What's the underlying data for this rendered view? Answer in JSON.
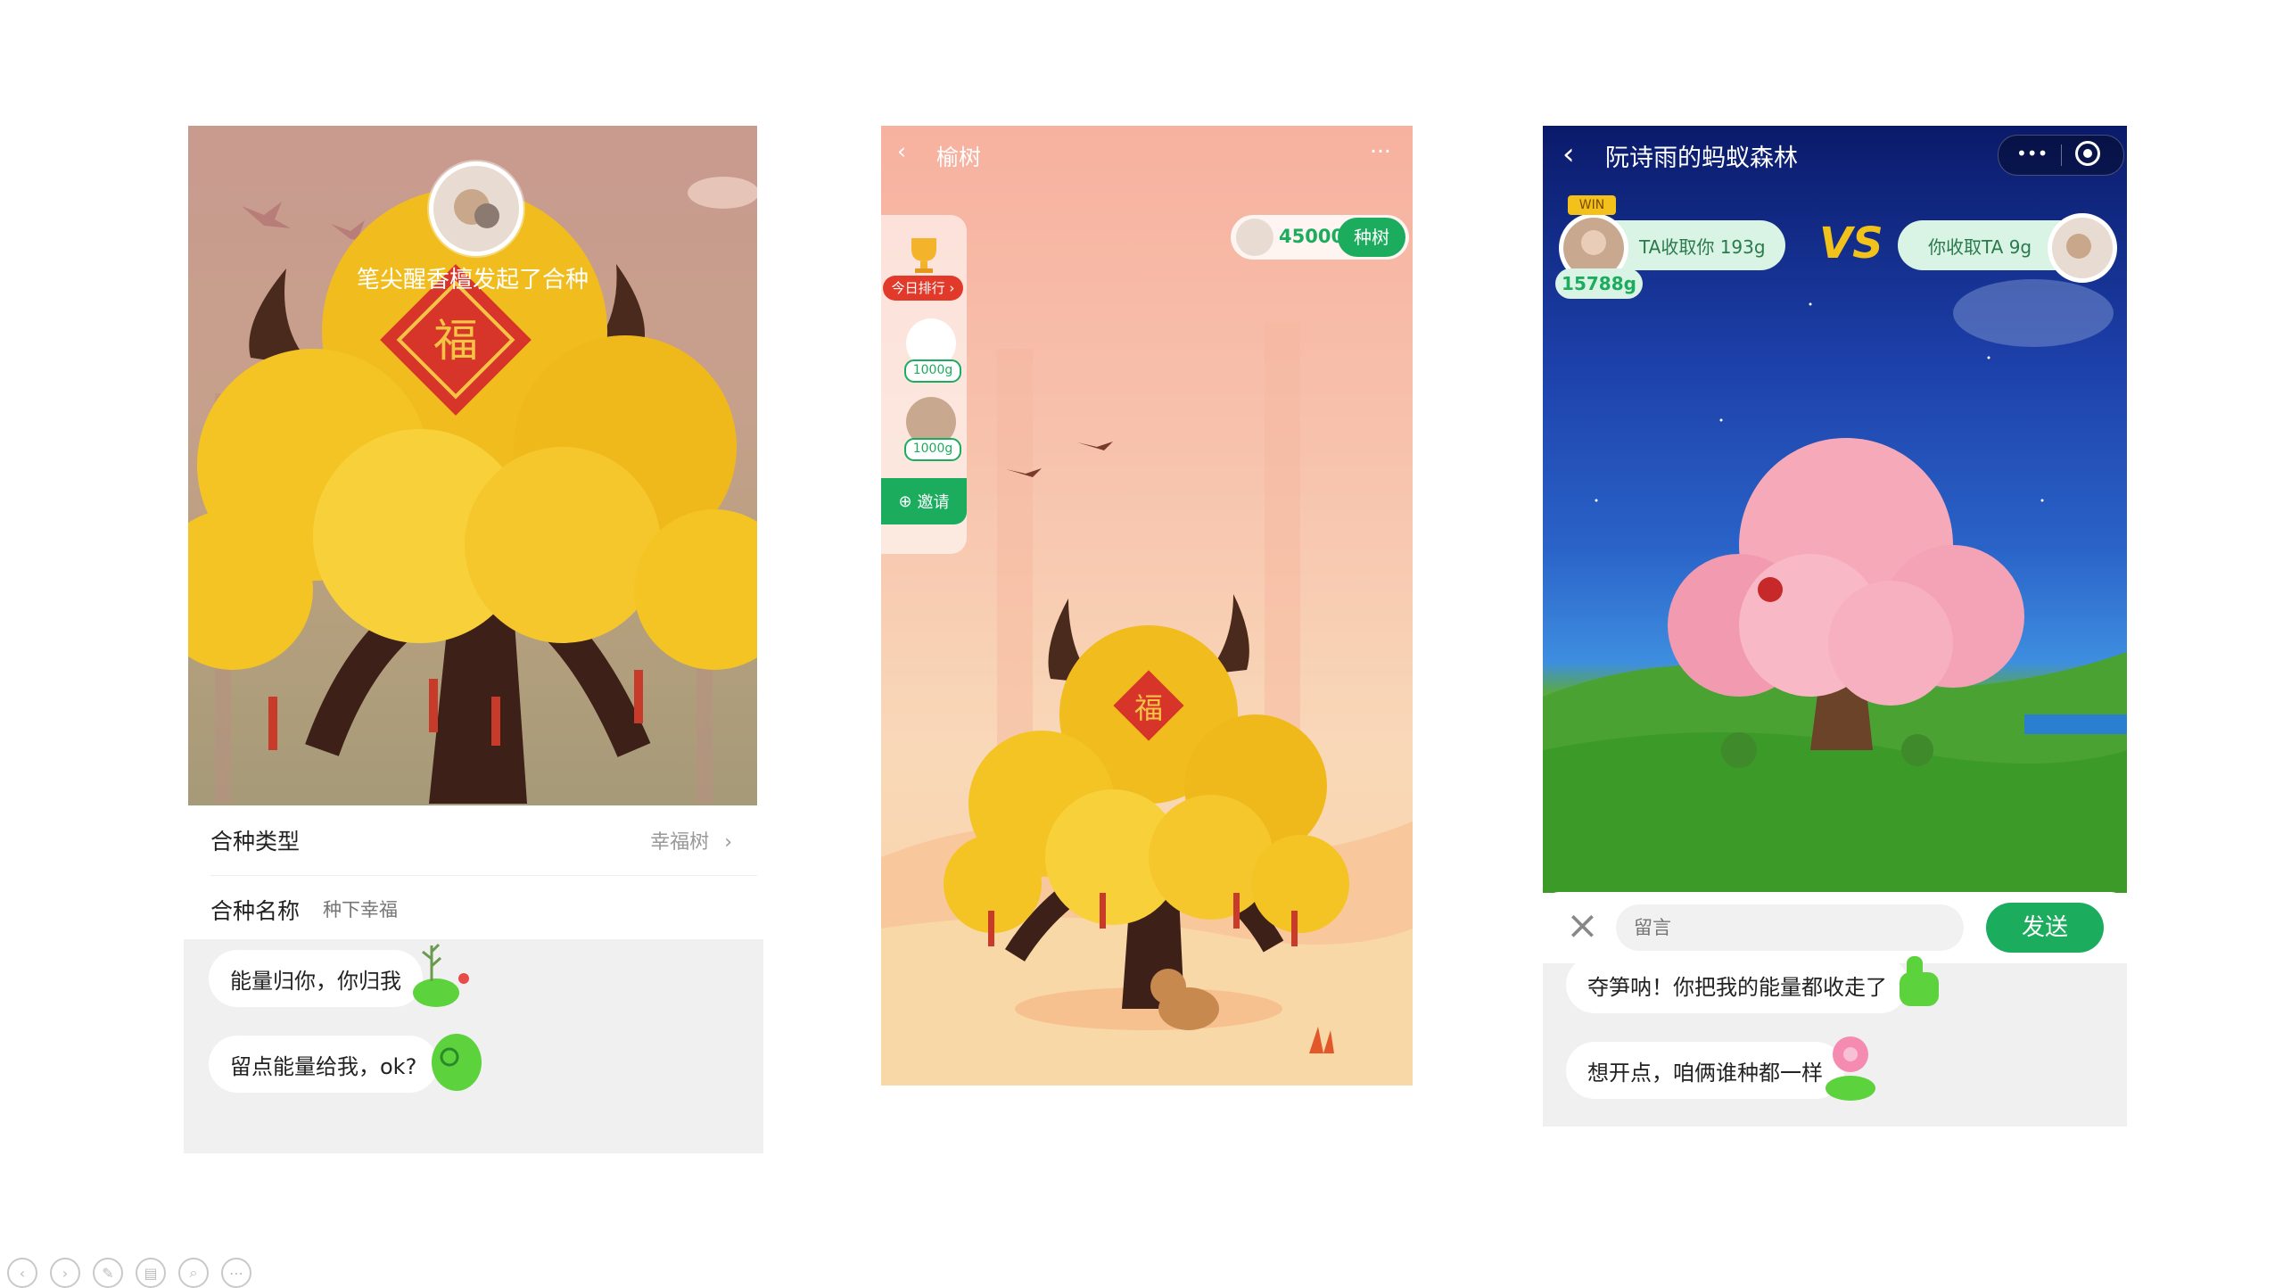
{
  "panel1": {
    "banner_title": "笔尖醒香檀发起了合种",
    "rows": [
      {
        "label": "合种类型",
        "value": "幸福树"
      },
      {
        "label": "合种名称",
        "placeholder": "种下幸福"
      }
    ],
    "messages": [
      "能量归你，你归我",
      "留点能量给我，ok?"
    ]
  },
  "panel2": {
    "nav_title": "榆树",
    "more": "···",
    "rank_button": "今日排行",
    "rank": [
      {
        "grams": "1000g"
      },
      {
        "grams": "1000g"
      }
    ],
    "invite": "邀请",
    "energy": "45000g",
    "plant_button": "种树"
  },
  "panel3": {
    "nav_title": "阮诗雨的蚂蚁森林",
    "capsule_more": "•••",
    "win_badge": "WIN",
    "friend_total": "15788g",
    "ta_collected": "TA收取你 193g",
    "vs": "VS",
    "you_collected": "你收取TA 9g",
    "comment_placeholder": "留言",
    "send_button": "发送",
    "messages": [
      "夺笋呐！你把我的能量都收走了",
      "想开点，咱俩谁种都一样"
    ]
  },
  "colors": {
    "brand_green": "#1cac5e",
    "red_button": "#e23a2a"
  }
}
